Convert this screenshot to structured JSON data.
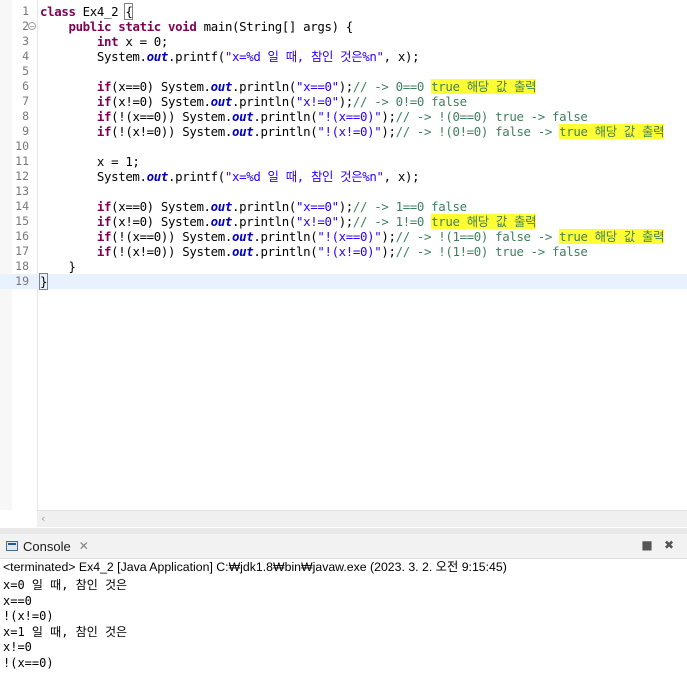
{
  "editor": {
    "lines": [
      {
        "n": "1",
        "segs": [
          {
            "t": "class",
            "c": "kw"
          },
          {
            "t": " Ex4_2 "
          },
          {
            "t": "{",
            "c": "bracket"
          }
        ]
      },
      {
        "n": "2",
        "fold": "⊖",
        "segs": [
          {
            "t": "    "
          },
          {
            "t": "public",
            "c": "kw"
          },
          {
            "t": " "
          },
          {
            "t": "static",
            "c": "kw"
          },
          {
            "t": " "
          },
          {
            "t": "void",
            "c": "kw"
          },
          {
            "t": " main(String[] args) {"
          }
        ]
      },
      {
        "n": "3",
        "segs": [
          {
            "t": "        "
          },
          {
            "t": "int",
            "c": "kw"
          },
          {
            "t": " x = 0;"
          }
        ]
      },
      {
        "n": "4",
        "segs": [
          {
            "t": "        System."
          },
          {
            "t": "out",
            "c": "fld"
          },
          {
            "t": ".printf("
          },
          {
            "t": "\"x=%d 일 때, 참인 것은%n\"",
            "c": "str"
          },
          {
            "t": ", x);"
          }
        ]
      },
      {
        "n": "5",
        "segs": []
      },
      {
        "n": "6",
        "segs": [
          {
            "t": "        "
          },
          {
            "t": "if",
            "c": "kw"
          },
          {
            "t": "(x==0) System."
          },
          {
            "t": "out",
            "c": "fld"
          },
          {
            "t": ".println("
          },
          {
            "t": "\"x==0\"",
            "c": "str"
          },
          {
            "t": ");"
          },
          {
            "t": "// -> 0==0 ",
            "c": "cm"
          },
          {
            "t": "true 해당 값 출력",
            "c": "cm hl"
          }
        ]
      },
      {
        "n": "7",
        "segs": [
          {
            "t": "        "
          },
          {
            "t": "if",
            "c": "kw"
          },
          {
            "t": "(x!=0) System."
          },
          {
            "t": "out",
            "c": "fld"
          },
          {
            "t": ".println("
          },
          {
            "t": "\"x!=0\"",
            "c": "str"
          },
          {
            "t": ");"
          },
          {
            "t": "// -> 0!=0 false",
            "c": "cm"
          }
        ]
      },
      {
        "n": "8",
        "segs": [
          {
            "t": "        "
          },
          {
            "t": "if",
            "c": "kw"
          },
          {
            "t": "(!(x==0)) System."
          },
          {
            "t": "out",
            "c": "fld"
          },
          {
            "t": ".println("
          },
          {
            "t": "\"!(x==0)\"",
            "c": "str"
          },
          {
            "t": ");"
          },
          {
            "t": "// -> !(0==0) true -> false",
            "c": "cm"
          }
        ]
      },
      {
        "n": "9",
        "segs": [
          {
            "t": "        "
          },
          {
            "t": "if",
            "c": "kw"
          },
          {
            "t": "(!(x!=0)) System."
          },
          {
            "t": "out",
            "c": "fld"
          },
          {
            "t": ".println("
          },
          {
            "t": "\"!(x!=0)\"",
            "c": "str"
          },
          {
            "t": ");"
          },
          {
            "t": "// -> !(0!=0) false -> ",
            "c": "cm"
          },
          {
            "t": "true 해당 값 출력",
            "c": "cm hl"
          }
        ]
      },
      {
        "n": "10",
        "segs": []
      },
      {
        "n": "11",
        "segs": [
          {
            "t": "        x = 1;"
          }
        ]
      },
      {
        "n": "12",
        "segs": [
          {
            "t": "        System."
          },
          {
            "t": "out",
            "c": "fld"
          },
          {
            "t": ".printf("
          },
          {
            "t": "\"x=%d 일 때, 참인 것은%n\"",
            "c": "str"
          },
          {
            "t": ", x);"
          }
        ]
      },
      {
        "n": "13",
        "segs": []
      },
      {
        "n": "14",
        "segs": [
          {
            "t": "        "
          },
          {
            "t": "if",
            "c": "kw"
          },
          {
            "t": "(x==0) System."
          },
          {
            "t": "out",
            "c": "fld"
          },
          {
            "t": ".println("
          },
          {
            "t": "\"x==0\"",
            "c": "str"
          },
          {
            "t": ");"
          },
          {
            "t": "// -> 1==0 false",
            "c": "cm"
          }
        ]
      },
      {
        "n": "15",
        "segs": [
          {
            "t": "        "
          },
          {
            "t": "if",
            "c": "kw"
          },
          {
            "t": "(x!=0) System."
          },
          {
            "t": "out",
            "c": "fld"
          },
          {
            "t": ".println("
          },
          {
            "t": "\"x!=0\"",
            "c": "str"
          },
          {
            "t": ");"
          },
          {
            "t": "// -> 1!=0 ",
            "c": "cm"
          },
          {
            "t": "true 해당 값 출력",
            "c": "cm hl"
          }
        ]
      },
      {
        "n": "16",
        "segs": [
          {
            "t": "        "
          },
          {
            "t": "if",
            "c": "kw"
          },
          {
            "t": "(!(x==0)) System."
          },
          {
            "t": "out",
            "c": "fld"
          },
          {
            "t": ".println("
          },
          {
            "t": "\"!(x==0)\"",
            "c": "str"
          },
          {
            "t": ");"
          },
          {
            "t": "// -> !(1==0) false -> ",
            "c": "cm"
          },
          {
            "t": "true 해당 값 출력",
            "c": "cm hl"
          }
        ]
      },
      {
        "n": "17",
        "segs": [
          {
            "t": "        "
          },
          {
            "t": "if",
            "c": "kw"
          },
          {
            "t": "(!(x!=0)) System."
          },
          {
            "t": "out",
            "c": "fld"
          },
          {
            "t": ".println("
          },
          {
            "t": "\"!(x!=0)\"",
            "c": "str"
          },
          {
            "t": ");"
          },
          {
            "t": "// -> !(1!=0) true -> false",
            "c": "cm"
          }
        ]
      },
      {
        "n": "18",
        "segs": [
          {
            "t": "    }"
          }
        ]
      },
      {
        "n": "19",
        "segs": [
          {
            "t": "}",
            "c": "bracket"
          }
        ]
      }
    ],
    "scroll_left_icon": "chevron-left-icon"
  },
  "console": {
    "tab_label": "Console",
    "tab_close_icon": "close-icon",
    "terminated_text": "<terminated> Ex4_2 [Java Application] C:₩jdk1.8₩bin₩javaw.exe (2023. 3. 2. 오전 9:15:45)",
    "output_lines": [
      "x=0 일 때, 참인 것은",
      "x==0",
      "!(x!=0)",
      "x=1 일 때, 참인 것은",
      "x!=0",
      "!(x==0)"
    ]
  }
}
